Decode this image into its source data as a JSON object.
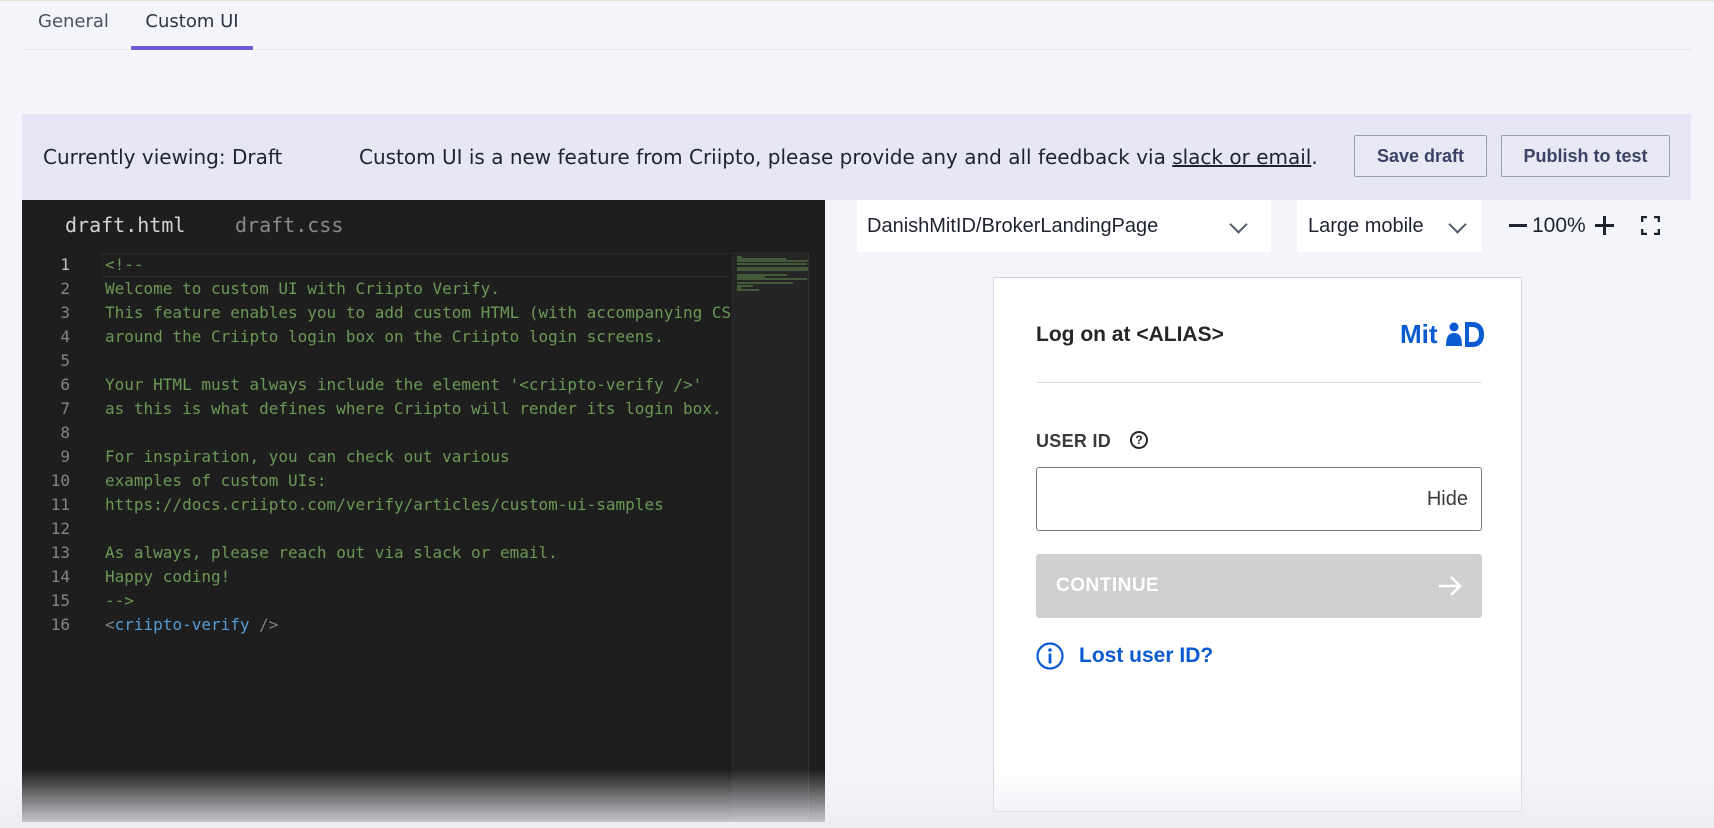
{
  "tabs": [
    {
      "label": "General",
      "active": false
    },
    {
      "label": "Custom UI",
      "active": true
    }
  ],
  "banner": {
    "viewing": "Currently viewing: Draft",
    "notice_prefix": "Custom UI is a new feature from Criipto, please provide any and all feedback via ",
    "notice_link": "slack or email",
    "notice_suffix": ".",
    "save_label": "Save draft",
    "publish_label": "Publish to test"
  },
  "editor": {
    "tabs": [
      "draft.html",
      "draft.css"
    ],
    "active_tab": "draft.html",
    "active_line": 1,
    "lines": [
      {
        "num": "1",
        "text": "<!--"
      },
      {
        "num": "2",
        "text": "Welcome to custom UI with Criipto Verify."
      },
      {
        "num": "3",
        "text": "This feature enables you to add custom HTML (with accompanying CS"
      },
      {
        "num": "4",
        "text": "around the Criipto login box on the Criipto login screens."
      },
      {
        "num": "5",
        "text": ""
      },
      {
        "num": "6",
        "text": "Your HTML must always include the element '<criipto-verify />'"
      },
      {
        "num": "7",
        "text": "as this is what defines where Criipto will render its login box."
      },
      {
        "num": "8",
        "text": ""
      },
      {
        "num": "9",
        "text": "For inspiration, you can check out various"
      },
      {
        "num": "10",
        "text": "examples of custom UIs:"
      },
      {
        "num": "11",
        "text": "https://docs.criipto.com/verify/articles/custom-ui-samples"
      },
      {
        "num": "12",
        "text": ""
      },
      {
        "num": "13",
        "text": "As always, please reach out via slack or email."
      },
      {
        "num": "14",
        "text": "Happy coding!"
      },
      {
        "num": "15",
        "text": "-->"
      }
    ],
    "last_line": {
      "num": "16",
      "open": "<",
      "tag": "criipto-verify",
      "close": " />"
    }
  },
  "preview": {
    "page_select": "DanishMitID/BrokerLandingPage",
    "device_select": "Large mobile",
    "zoom": "100%"
  },
  "login": {
    "title": "Log on at <ALIAS>",
    "logo_text": "Mit",
    "user_id_label": "USER ID",
    "help_glyph": "?",
    "input_value": "",
    "hide_label": "Hide",
    "continue_label": "CONTINUE",
    "lost_label": "Lost user ID?"
  },
  "colors": {
    "accent": "#6c5ad6",
    "mitid_blue": "#0a5bd1",
    "editor_bg": "#1e1e1e",
    "comment_green": "#6a9955",
    "tag_blue": "#569cd6",
    "disabled_button": "#cfcfcf"
  },
  "icons": {
    "select_chevron": "chevron-down-icon",
    "zoom_out": "minus-icon",
    "zoom_in": "plus-icon",
    "fullscreen": "fullscreen-icon",
    "help": "help-circle-icon",
    "continue": "arrow-right-icon",
    "info": "info-circle-icon",
    "logo": "mitid-logo"
  }
}
